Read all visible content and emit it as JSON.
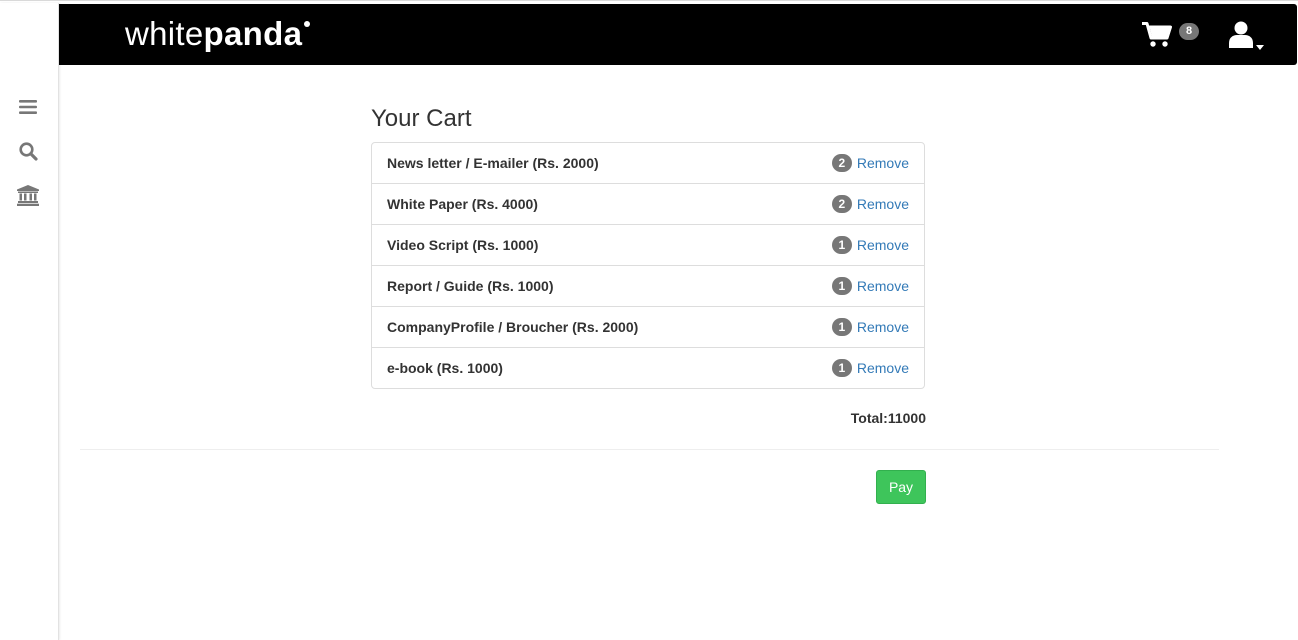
{
  "brand": {
    "logo_light": "white",
    "logo_bold": "panda"
  },
  "header": {
    "cart_count": "8",
    "cart_icon": "shopping-cart-icon",
    "user_icon": "user-icon",
    "user_caret_icon": "caret-down-icon"
  },
  "sidebar": {
    "items": [
      {
        "icon": "menu-icon"
      },
      {
        "icon": "search-icon"
      },
      {
        "icon": "bank-icon"
      }
    ]
  },
  "cart": {
    "title": "Your Cart",
    "items": [
      {
        "name": "News letter / E-mailer (Rs. 2000)",
        "qty": "2",
        "remove_label": "Remove"
      },
      {
        "name": "White Paper (Rs. 4000)",
        "qty": "2",
        "remove_label": "Remove"
      },
      {
        "name": "Video Script (Rs. 1000)",
        "qty": "1",
        "remove_label": "Remove"
      },
      {
        "name": "Report / Guide (Rs. 1000)",
        "qty": "1",
        "remove_label": "Remove"
      },
      {
        "name": "CompanyProfile / Broucher (Rs. 2000)",
        "qty": "1",
        "remove_label": "Remove"
      },
      {
        "name": "e-book (Rs. 1000)",
        "qty": "1",
        "remove_label": "Remove"
      }
    ],
    "total_label": "Total:11000",
    "pay_label": "Pay"
  },
  "colors": {
    "navbar_bg": "#000000",
    "link": "#337ab7",
    "badge": "#777777",
    "pay_button": "#3ec55b"
  }
}
